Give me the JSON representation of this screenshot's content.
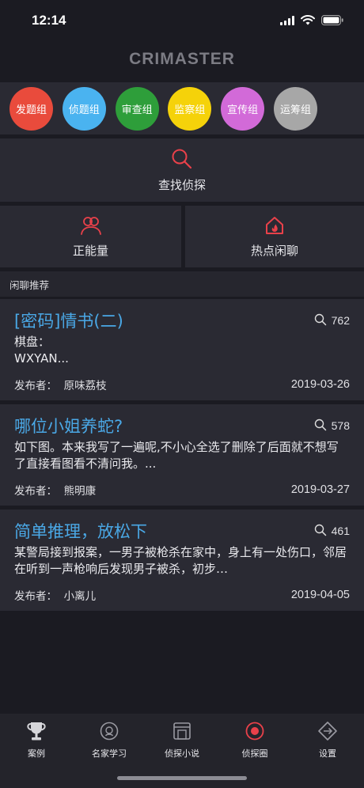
{
  "status_bar": {
    "time": "12:14"
  },
  "app": {
    "title": "CRIMASTER"
  },
  "groups": [
    {
      "label": "发题组",
      "color": "#e94b3c"
    },
    {
      "label": "侦题组",
      "color": "#4ab3f0"
    },
    {
      "label": "审查组",
      "color": "#2e9e3a"
    },
    {
      "label": "监察组",
      "color": "#f5d20a"
    },
    {
      "label": "宣传组",
      "color": "#d26ad8"
    },
    {
      "label": "运筹组",
      "color": "#a7a7a7"
    }
  ],
  "search": {
    "label": "查找侦探",
    "icon": "search-icon"
  },
  "tiles": [
    {
      "label": "正能量",
      "icon": "users-icon"
    },
    {
      "label": "热点闲聊",
      "icon": "home-fire-icon"
    }
  ],
  "section": {
    "title": "闲聊推荐"
  },
  "posts": [
    {
      "title": "[密码]情书(二)",
      "views": "762",
      "body": "棋盘：\nWXYAN...",
      "author_label": "发布者：",
      "author": "原味荔枝",
      "date": "2019-03-26"
    },
    {
      "title": "哪位小姐养蛇?",
      "views": "578",
      "body": "如下图。本来我写了一遍呢,不小心全选了删除了后面就不想写了直接看图看不清问我。...",
      "author_label": "发布者：",
      "author": "熊明康",
      "date": "2019-03-27"
    },
    {
      "title": "简单推理，放松下",
      "views": "461",
      "body": "某警局接到报案，一男子被枪杀在家中，身上有一处伤口，邻居在听到一声枪响后发现男子被杀，初步…",
      "author_label": "发布者：",
      "author": "小离儿",
      "date": "2019-04-05"
    }
  ],
  "tabs": [
    {
      "label": "案例",
      "icon": "trophy-icon",
      "active": false
    },
    {
      "label": "名家学习",
      "icon": "badge-icon",
      "active": false
    },
    {
      "label": "侦探小说",
      "icon": "book-icon",
      "active": false
    },
    {
      "label": "侦探圈",
      "icon": "target-icon",
      "active": true
    },
    {
      "label": "设置",
      "icon": "settings-icon",
      "active": false
    }
  ],
  "colors": {
    "accent_red": "#e9414a",
    "title_blue": "#4aa8e6",
    "background": "#1b1b22",
    "panel": "#2a2a33"
  }
}
